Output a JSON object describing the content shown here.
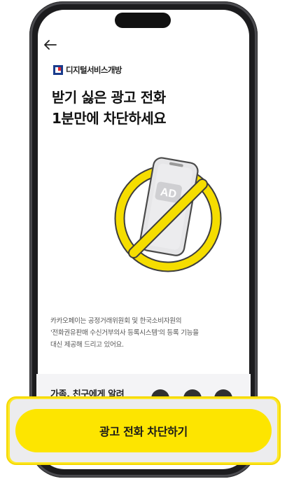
{
  "header": {
    "back_icon": "arrow-left-icon"
  },
  "brand": {
    "name": "디지털서비스개방"
  },
  "headline": {
    "line1": "받기 싫은 광고 전화",
    "line2": "1분만에 차단하세요"
  },
  "illustration": {
    "phone_badge": "AD",
    "ring_color": "#f5dd00",
    "ring_stroke": "#3d3d3d"
  },
  "description": [
    "카카오페이는 공정거래위원회 및 한국소비자원의",
    "'전화권유판매 수신거부의사 등록시스템'의 등록 기능을",
    "대신 제공해 드리고 있어요."
  ],
  "share": {
    "label": "가족, 친구에게 알려"
  },
  "cta": {
    "label": "광고 전화 차단하기"
  },
  "colors": {
    "accent": "#fde500",
    "text": "#111111"
  }
}
